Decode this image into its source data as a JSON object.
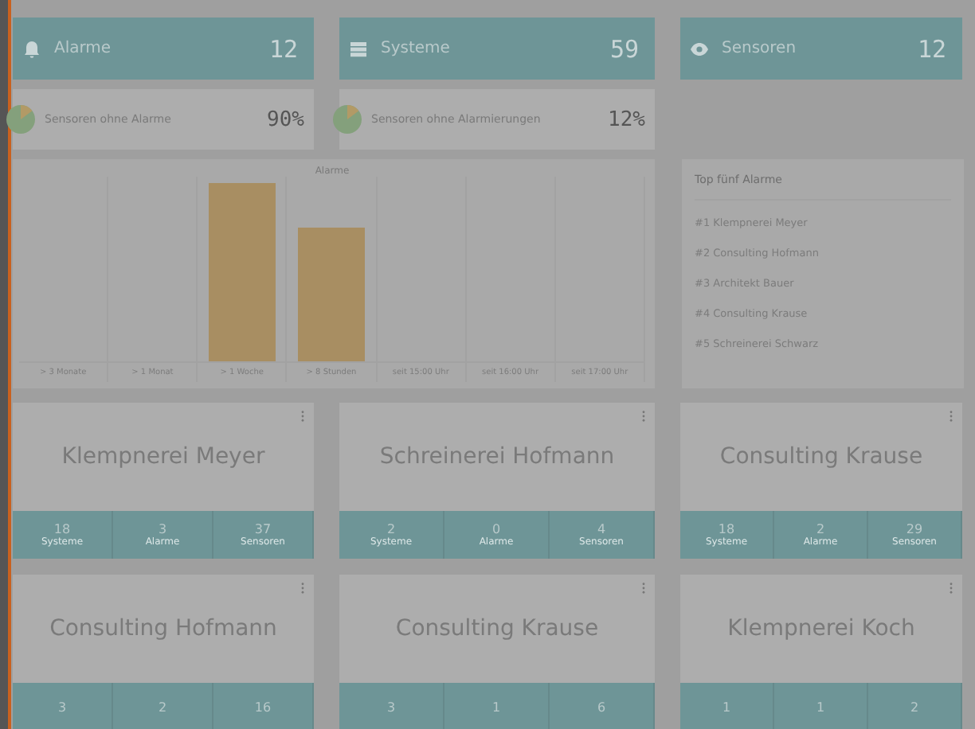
{
  "summary_cards": [
    {
      "title": "Alarme",
      "count": "12",
      "stat_label": "Sensoren ohne Alarme",
      "stat_value": "90%"
    },
    {
      "title": "Systeme",
      "count": "59",
      "stat_label": "Sensoren ohne Alarmierungen",
      "stat_value": "12%"
    },
    {
      "title": "Sensoren",
      "count": "12"
    }
  ],
  "alarm_chart": {
    "title": "Alarme",
    "categories": [
      "> 3 Monate",
      "> 1 Monat",
      "> 1 Woche",
      "> 8 Stunden",
      "seit 15:00 Uhr",
      "seit 16:00 Uhr",
      "seit 17:00 Uhr"
    ]
  },
  "top_alarms": {
    "title": "Top fünf Alarme",
    "items": [
      {
        "rank": "#1",
        "name": "Klempnerei Meyer"
      },
      {
        "rank": "#2",
        "name": "Consulting Hofmann"
      },
      {
        "rank": "#3",
        "name": "Architekt Bauer"
      },
      {
        "rank": "#4",
        "name": "Consulting Krause"
      },
      {
        "rank": "#5",
        "name": "Schreinerei Schwarz"
      }
    ]
  },
  "customers": [
    {
      "name": "Klempnerei Meyer",
      "stats": [
        {
          "value": "18",
          "label": "Systeme"
        },
        {
          "value": "3",
          "label": "Alarme"
        },
        {
          "value": "37",
          "label": "Sensoren"
        }
      ]
    },
    {
      "name": "Schreinerei Hofmann",
      "stats": [
        {
          "value": "2",
          "label": "Systeme"
        },
        {
          "value": "0",
          "label": "Alarme"
        },
        {
          "value": "4",
          "label": "Sensoren"
        }
      ]
    },
    {
      "name": "Consulting Krause",
      "stats": [
        {
          "value": "18",
          "label": "Systeme"
        },
        {
          "value": "2",
          "label": "Alarme"
        },
        {
          "value": "29",
          "label": "Sensoren"
        }
      ]
    },
    {
      "name": "Consulting Hofmann",
      "stats": [
        {
          "value": "3"
        },
        {
          "value": "2"
        },
        {
          "value": "16"
        }
      ]
    },
    {
      "name": "Consulting Krause",
      "stats": [
        {
          "value": "3"
        },
        {
          "value": "1"
        },
        {
          "value": "6"
        }
      ]
    },
    {
      "name": "Klempnerei Koch",
      "stats": [
        {
          "value": "1"
        },
        {
          "value": "1"
        },
        {
          "value": "2"
        }
      ]
    }
  ]
}
